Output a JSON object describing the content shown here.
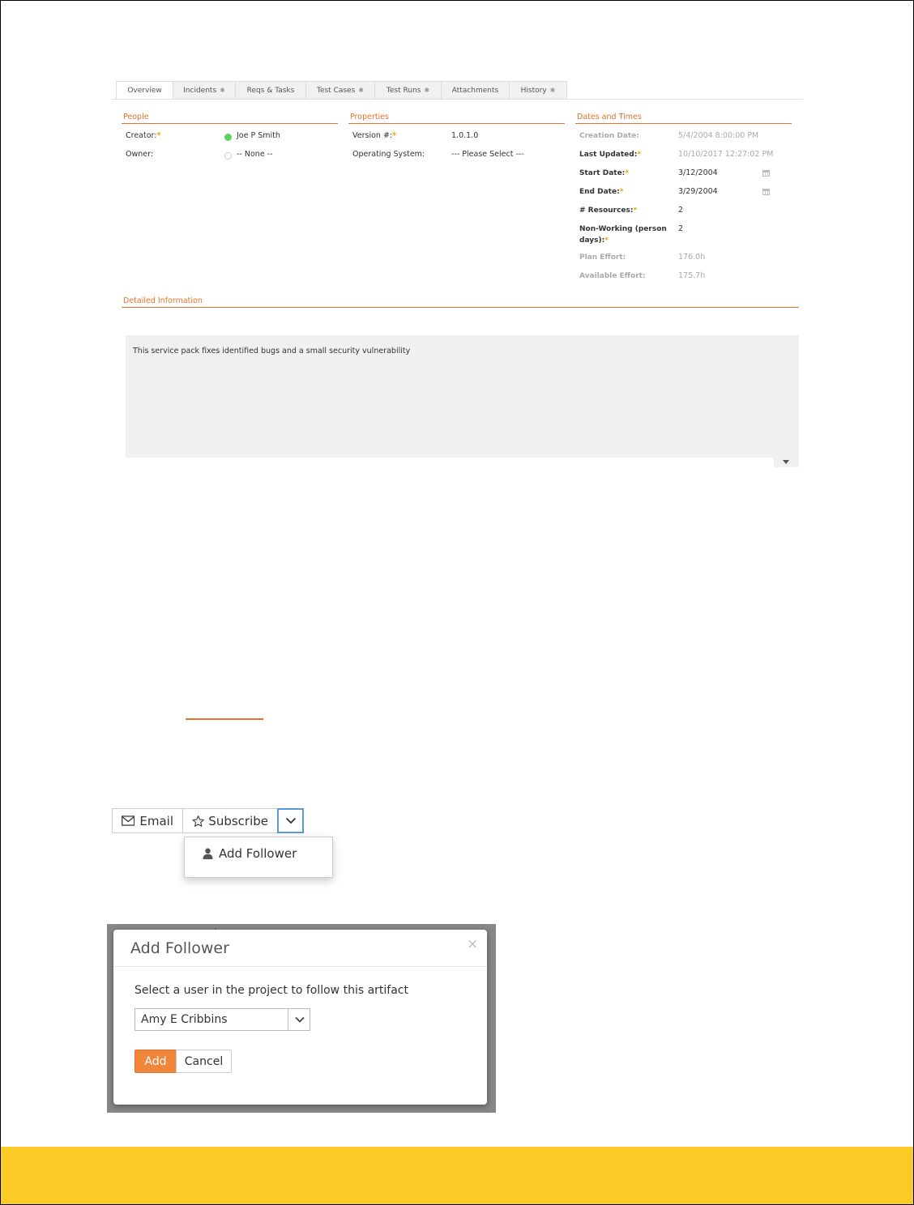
{
  "tabs": [
    {
      "label": "Overview",
      "dot": ""
    },
    {
      "label": "Incidents",
      "dot": "✱"
    },
    {
      "label": "Reqs & Tasks",
      "dot": ""
    },
    {
      "label": "Test Cases",
      "dot": "✱"
    },
    {
      "label": "Test Runs",
      "dot": "✱"
    },
    {
      "label": "Attachments",
      "dot": ""
    },
    {
      "label": "History",
      "dot": "✱"
    }
  ],
  "people": {
    "title": "People",
    "creator_label": "Creator:",
    "creator_value": "Joe P Smith",
    "owner_label": "Owner:",
    "owner_value": "-- None --"
  },
  "properties": {
    "title": "Properties",
    "version_label": "Version #:",
    "version_value": "1.0.1.0",
    "os_label": "Operating System:",
    "os_value": "--- Please Select ---"
  },
  "dates": {
    "title": "Dates and Times",
    "creation_label": "Creation Date:",
    "creation_value": "5/4/2004 8:00:00 PM",
    "updated_label": "Last Updated:",
    "updated_value": "10/10/2017 12:27:02 PM",
    "start_label": "Start Date:",
    "start_value": "3/12/2004",
    "end_label": "End Date:",
    "end_value": "3/29/2004",
    "resources_label": "# Resources:",
    "resources_value": "2",
    "nonworking_label_1": "Non-Working (person",
    "nonworking_label_2": "days):",
    "nonworking_value": "2",
    "plan_label": "Plan Effort:",
    "plan_value": "176.0h",
    "available_label": "Available Effort:",
    "available_value": "175.7h"
  },
  "detailed": {
    "title": "Detailed Information",
    "text": "This service pack fixes identified bugs and a small security vulnerability"
  },
  "actions": {
    "email_label": "Email",
    "subscribe_label": "Subscribe",
    "add_follower_item": "Add Follower"
  },
  "modal": {
    "title": "Add Follower",
    "close": "×",
    "instruction": "Select a user in the project to follow this artifact",
    "selected_user": "Amy E Cribbins",
    "add_label": "Add",
    "cancel_label": "Cancel"
  },
  "colors": {
    "accent": "#e2722e",
    "required": "#f5a000",
    "status_active": "#5cd25c",
    "footer": "#fbcb25"
  }
}
